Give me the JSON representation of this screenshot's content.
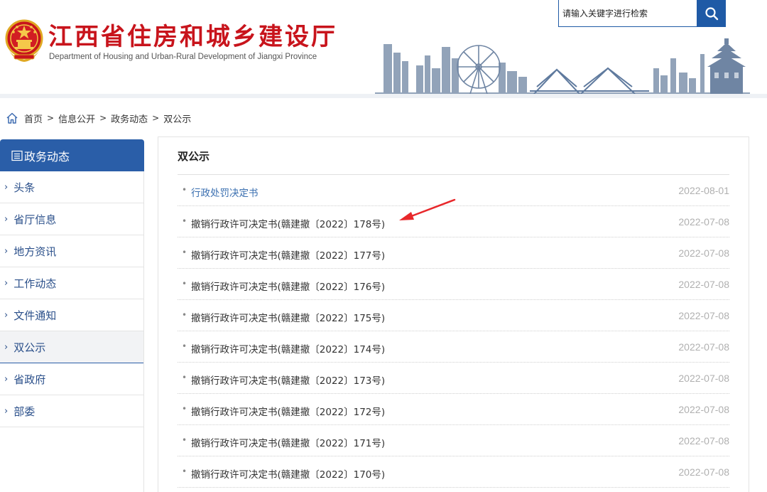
{
  "header": {
    "title": "江西省住房和城乡建设厅",
    "subtitle": "Department of Housing and Urban-Rural Development of Jiangxi Province",
    "emblem_icon": "national-emblem-icon",
    "skyline_icon": "city-skyline-icon"
  },
  "search": {
    "placeholder": "请输入关键字进行检索",
    "button_icon": "search-icon"
  },
  "breadcrumb": {
    "home_icon": "home-icon",
    "items": [
      "首页",
      "信息公开",
      "政务动态",
      "双公示"
    ],
    "separator": ">"
  },
  "sidebar": {
    "header": "政务动态",
    "header_icon": "list-icon",
    "items": [
      {
        "label": "头条",
        "active": false
      },
      {
        "label": "省厅信息",
        "active": false
      },
      {
        "label": "地方资讯",
        "active": false
      },
      {
        "label": "工作动态",
        "active": false
      },
      {
        "label": "文件通知",
        "active": false
      },
      {
        "label": "双公示",
        "active": true
      },
      {
        "label": "省政府",
        "active": false
      },
      {
        "label": "部委",
        "active": false
      }
    ]
  },
  "content": {
    "title": "双公示",
    "articles": [
      {
        "title": "行政处罚决定书",
        "date": "2022-08-01"
      },
      {
        "title": "撤销行政许可决定书(赣建撤〔2022〕178号)",
        "date": "2022-07-08"
      },
      {
        "title": "撤销行政许可决定书(赣建撤〔2022〕177号)",
        "date": "2022-07-08"
      },
      {
        "title": "撤销行政许可决定书(赣建撤〔2022〕176号)",
        "date": "2022-07-08"
      },
      {
        "title": "撤销行政许可决定书(赣建撤〔2022〕175号)",
        "date": "2022-07-08"
      },
      {
        "title": "撤销行政许可决定书(赣建撤〔2022〕174号)",
        "date": "2022-07-08"
      },
      {
        "title": "撤销行政许可决定书(赣建撤〔2022〕173号)",
        "date": "2022-07-08"
      },
      {
        "title": "撤销行政许可决定书(赣建撤〔2022〕172号)",
        "date": "2022-07-08"
      },
      {
        "title": "撤销行政许可决定书(赣建撤〔2022〕171号)",
        "date": "2022-07-08"
      },
      {
        "title": "撤销行政许可决定书(赣建撤〔2022〕170号)",
        "date": "2022-07-08"
      }
    ]
  },
  "colors": {
    "brand_red": "#c8141c",
    "brand_blue": "#2a5ea8",
    "annotation_red": "#e8282b"
  },
  "annotation": {
    "icon": "red-arrow-annotation"
  }
}
